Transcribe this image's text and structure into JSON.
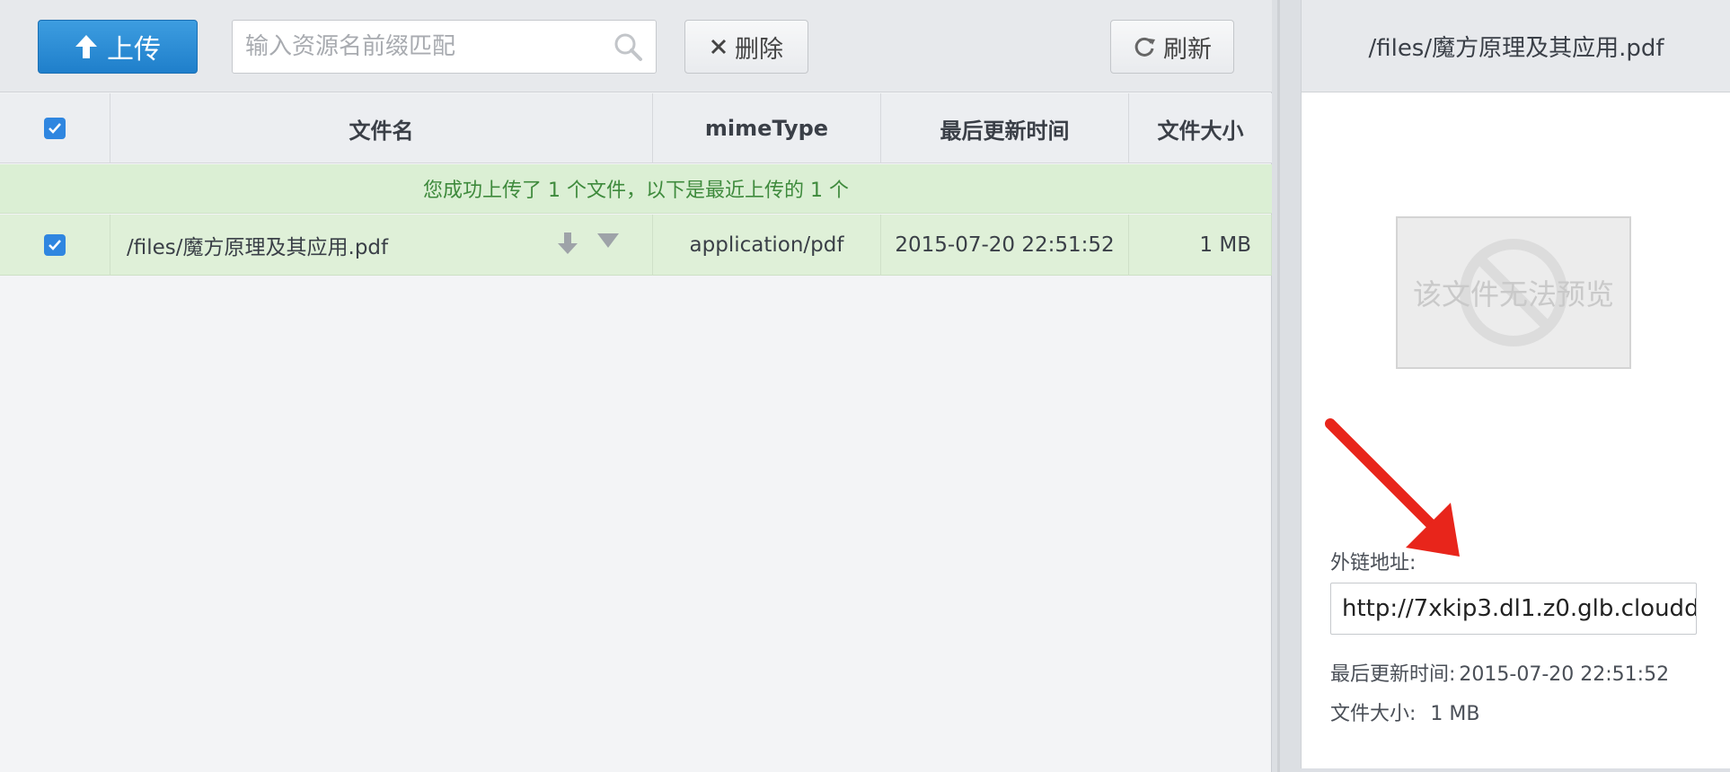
{
  "toolbar": {
    "upload_label": "上传",
    "search_placeholder": "输入资源名前缀匹配",
    "search_value": "",
    "delete_label": "删除",
    "refresh_label": "刷新"
  },
  "table": {
    "columns": [
      "文件名",
      "mimeType",
      "最后更新时间",
      "文件大小"
    ],
    "notice": "您成功上传了 1 个文件，以下是最近上传的 1 个",
    "rows": [
      {
        "name": "/files/魔方原理及其应用.pdf",
        "mime": "application/pdf",
        "updated": "2015-07-20 22:51:52",
        "size": "1 MB",
        "checked": true
      }
    ]
  },
  "detail": {
    "title": "/files/魔方原理及其应用.pdf",
    "preview_text": "该文件无法预览",
    "url_label": "外链地址:",
    "url_value": "http://7xkip3.dl1.z0.glb.clouddn",
    "updated_label": "最后更新时间:",
    "updated_value": "2015-07-20 22:51:52",
    "size_label": "文件大小:",
    "size_value": "1 MB"
  },
  "colors": {
    "primary": "#2f86e0",
    "success_bg": "#dff0d8",
    "success_text": "#3e8a3c",
    "annotation": "#e8251b"
  },
  "icons": [
    "arrow-up-icon",
    "search-icon",
    "close-icon",
    "refresh-icon",
    "checkbox-icon",
    "download-icon",
    "caret-down-icon",
    "no-preview-icon",
    "annotation-arrow"
  ]
}
